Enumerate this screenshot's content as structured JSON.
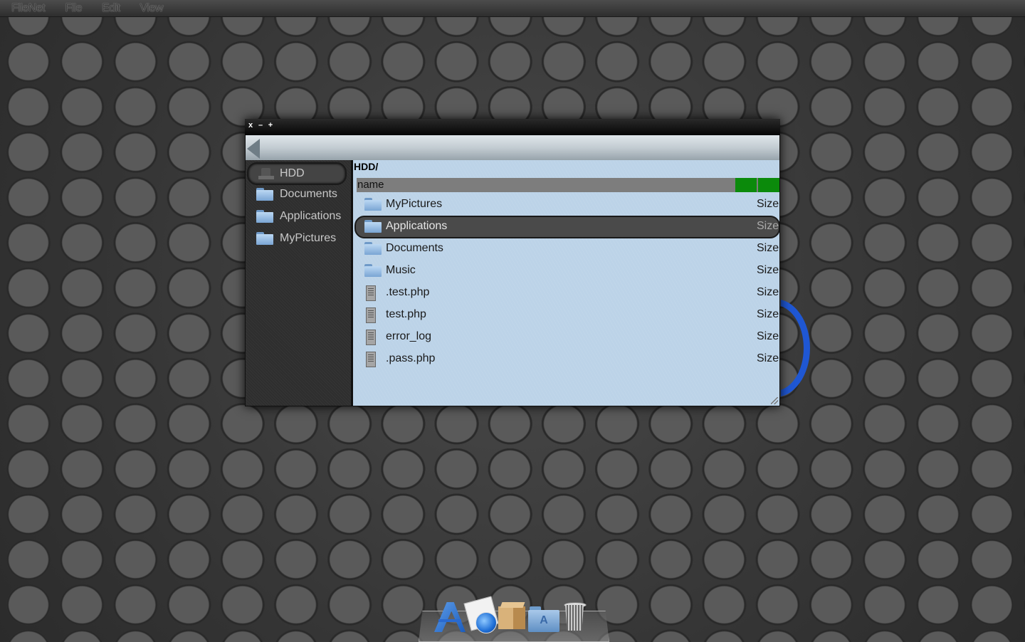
{
  "menubar": {
    "items": [
      "FileNet",
      "File",
      "Edit",
      "View"
    ]
  },
  "window": {
    "controls": {
      "close": "x",
      "minimize": "–",
      "maximize": "+"
    }
  },
  "sidebar": {
    "items": [
      {
        "label": "HDD",
        "icon": "hdd-icon",
        "active": true
      },
      {
        "label": "Documents",
        "icon": "folder-icon"
      },
      {
        "label": "Applications",
        "icon": "folder-icon"
      },
      {
        "label": "MyPictures",
        "icon": "folder-icon"
      }
    ]
  },
  "main": {
    "path": "HDD/",
    "column_header": "name",
    "files": [
      {
        "name": "MyPictures",
        "size": "Size",
        "type": "folder"
      },
      {
        "name": "Applications",
        "size": "Size",
        "type": "folder",
        "selected": true
      },
      {
        "name": "Documents",
        "size": "Size",
        "type": "folder"
      },
      {
        "name": "Music",
        "size": "Size",
        "type": "folder"
      },
      {
        "name": ".test.php",
        "size": "Size",
        "type": "file"
      },
      {
        "name": "test.php",
        "size": "Size",
        "type": "file"
      },
      {
        "name": "error_log",
        "size": "Size",
        "type": "file"
      },
      {
        "name": ".pass.php",
        "size": "Size",
        "type": "file"
      }
    ]
  },
  "dock": {
    "items": [
      "app-store-icon",
      "safari-icon",
      "package-icon",
      "applications-folder-icon",
      "trash-icon"
    ]
  },
  "colors": {
    "column_button": "#0b8a0b",
    "file_pane": "#bcd3e8",
    "selection": "#4a4a4a",
    "desktop_accent": "#1f57d3"
  }
}
